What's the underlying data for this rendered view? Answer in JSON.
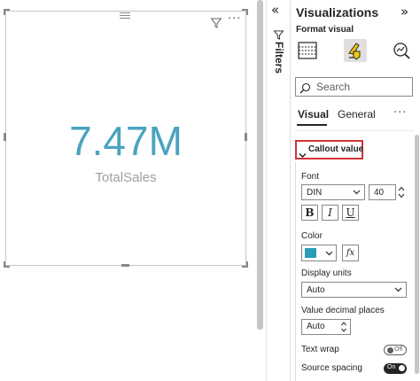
{
  "card_visual": {
    "value": "7.47M",
    "category_label": "TotalSales",
    "value_color": "#4aa3bf",
    "icons": [
      "drag-grip-icon",
      "filter-icon",
      "more-options-icon"
    ]
  },
  "filters_pane": {
    "label": "Filters",
    "collapse_glyph": "«"
  },
  "visualizations_pane": {
    "title": "Visualizations",
    "collapse_glyph": "»",
    "subtitle": "Format visual",
    "tools": [
      {
        "name": "build-visual-icon"
      },
      {
        "name": "format-visual-icon",
        "active": true
      },
      {
        "name": "analytics-icon"
      }
    ],
    "search": {
      "placeholder": "Search"
    },
    "tabs": [
      {
        "label": "Visual",
        "active": true
      },
      {
        "label": "General",
        "active": false
      }
    ],
    "tabs_more": "···",
    "section": {
      "title": "Callout value",
      "expanded": true,
      "highlight_color": "#d13438"
    },
    "font": {
      "label": "Font",
      "family_value": "DIN",
      "size_value": "40",
      "bold": "B",
      "italic": "I",
      "underline": "U"
    },
    "color": {
      "label": "Color",
      "swatch": "#2b9cb8",
      "fx": "fx"
    },
    "display_units": {
      "label": "Display units",
      "value": "Auto"
    },
    "decimal_places": {
      "label": "Value decimal places",
      "value": "Auto"
    },
    "text_wrap": {
      "label": "Text wrap",
      "state": "Off"
    },
    "source_spacing": {
      "label": "Source spacing",
      "state": "On"
    }
  }
}
